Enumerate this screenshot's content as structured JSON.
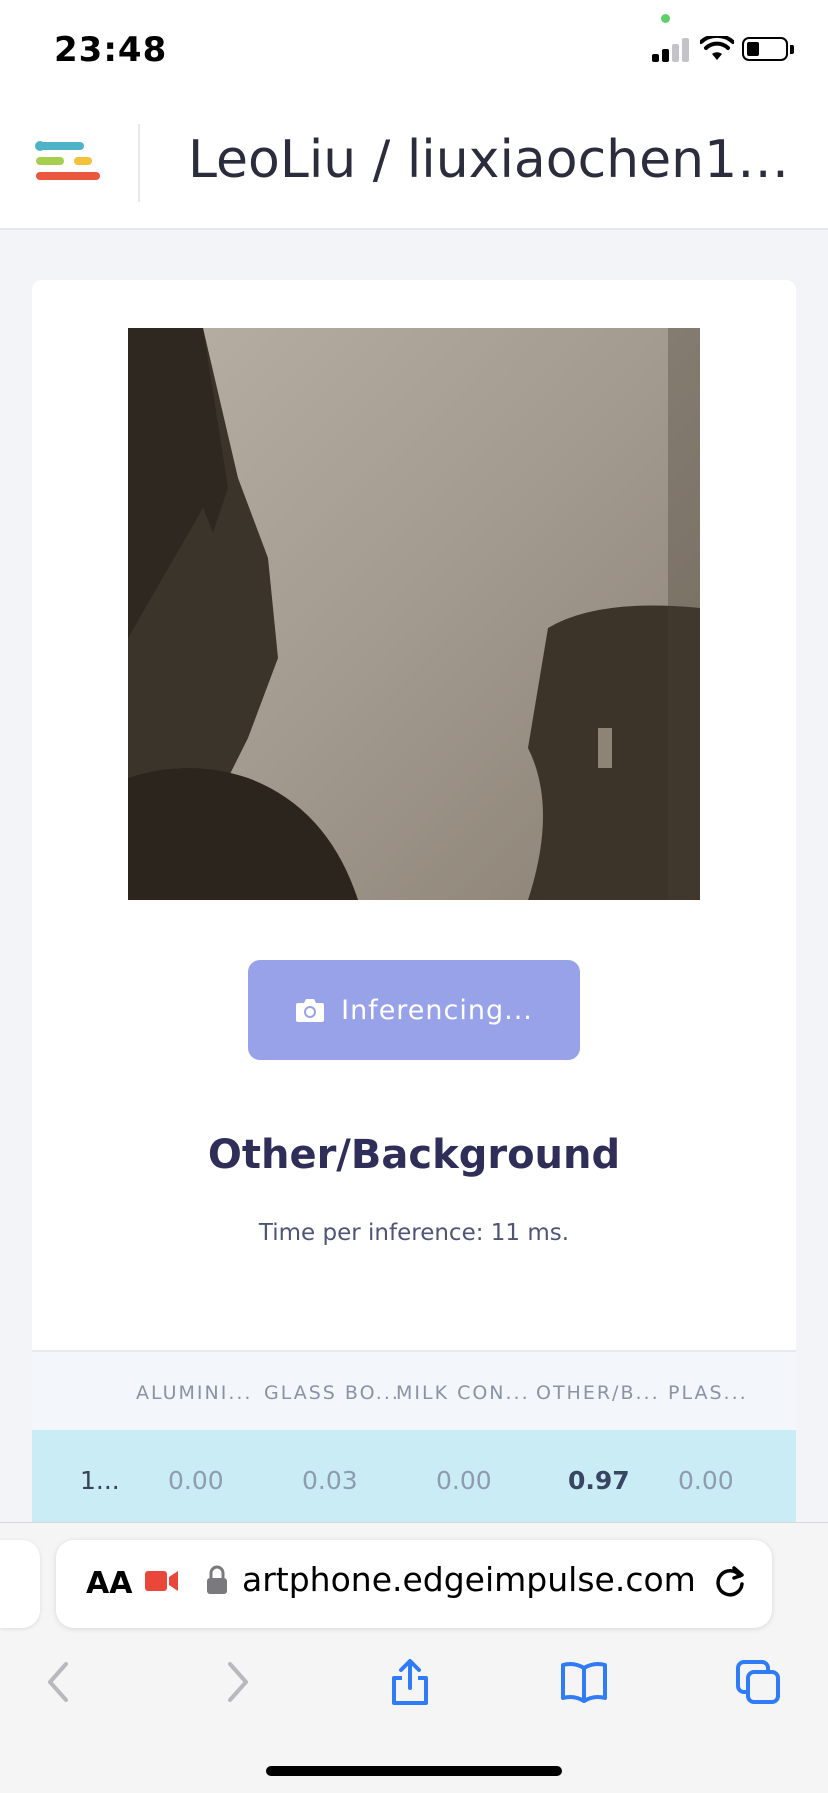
{
  "status": {
    "time": "23:48"
  },
  "header": {
    "title": "LeoLiu / liuxiaochen11-p..."
  },
  "main": {
    "button_label": "Inferencing...",
    "result": "Other/Background",
    "inference_time": "Time per inference: 11 ms."
  },
  "table": {
    "columns": [
      "ALUMINI...",
      "GLASS BO...",
      "MILK CON...",
      "OTHER/B...",
      "PLAS..."
    ],
    "row": {
      "index": "1...",
      "values": [
        "0.00",
        "0.03",
        "0.00",
        "0.97",
        "0.00"
      ]
    }
  },
  "browser": {
    "aa_label": "AA",
    "url": "artphone.edgeimpulse.com"
  },
  "colors": {
    "accent": "#98a2e8",
    "row_highlight": "#c9ecf5",
    "title_color": "#2f2e58"
  },
  "icons": [
    "camera-icon",
    "lock-icon",
    "reload-icon",
    "back-icon",
    "forward-icon",
    "share-icon",
    "bookmarks-icon",
    "tabs-icon"
  ]
}
